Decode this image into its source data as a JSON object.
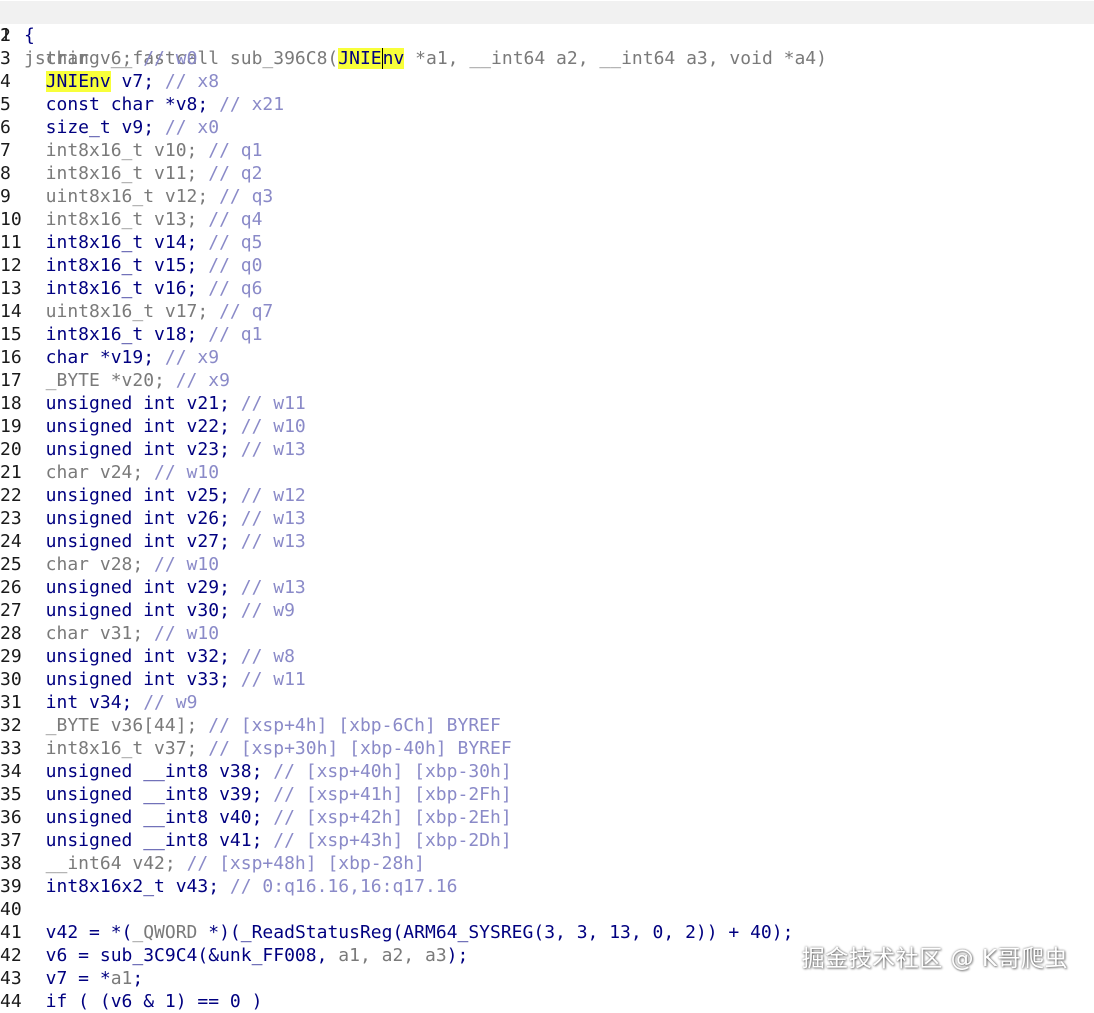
{
  "function_signature_parts": [
    {
      "t": "jstring __fastcall sub_396C8(",
      "c": "t-g"
    },
    {
      "t": "JNIE",
      "c": "t-n hl"
    },
    {
      "t": "nv",
      "c": "t-n hl cursor"
    },
    {
      "t": " *a1, __int64 a2, __int64 a3, void *a4)",
      "c": "t-g"
    }
  ],
  "lines": [
    {
      "n": "2",
      "parts": [
        {
          "t": "{",
          "c": "t-n"
        }
      ]
    },
    {
      "n": "3",
      "parts": [
        {
          "t": "  char v6; ",
          "c": "t-g"
        },
        {
          "t": "// w0",
          "c": "t-c"
        }
      ]
    },
    {
      "n": "4",
      "parts": [
        {
          "t": "  "
        },
        {
          "t": "JNIEnv",
          "c": "t-n hl"
        },
        {
          "t": " v7; ",
          "c": "t-n"
        },
        {
          "t": "// x8",
          "c": "t-c"
        }
      ]
    },
    {
      "n": "5",
      "parts": [
        {
          "t": "  const char *v8; ",
          "c": "t-n"
        },
        {
          "t": "// x21",
          "c": "t-c"
        }
      ]
    },
    {
      "n": "6",
      "parts": [
        {
          "t": "  size_t v9; ",
          "c": "t-n"
        },
        {
          "t": "// x0",
          "c": "t-c"
        }
      ]
    },
    {
      "n": "7",
      "parts": [
        {
          "t": "  int8x16_t v10; ",
          "c": "t-g"
        },
        {
          "t": "// q1",
          "c": "t-c"
        }
      ]
    },
    {
      "n": "8",
      "parts": [
        {
          "t": "  int8x16_t v11; ",
          "c": "t-g"
        },
        {
          "t": "// q2",
          "c": "t-c"
        }
      ]
    },
    {
      "n": "9",
      "parts": [
        {
          "t": "  uint8x16_t v12; ",
          "c": "t-g"
        },
        {
          "t": "// q3",
          "c": "t-c"
        }
      ]
    },
    {
      "n": "10",
      "parts": [
        {
          "t": "  int8x16_t v13; ",
          "c": "t-g"
        },
        {
          "t": "// q4",
          "c": "t-c"
        }
      ]
    },
    {
      "n": "11",
      "parts": [
        {
          "t": "  int8x16_t v14; ",
          "c": "t-n"
        },
        {
          "t": "// q5",
          "c": "t-c"
        }
      ]
    },
    {
      "n": "12",
      "parts": [
        {
          "t": "  int8x16_t v15; ",
          "c": "t-n"
        },
        {
          "t": "// q0",
          "c": "t-c"
        }
      ]
    },
    {
      "n": "13",
      "parts": [
        {
          "t": "  int8x16_t v16; ",
          "c": "t-n"
        },
        {
          "t": "// q6",
          "c": "t-c"
        }
      ]
    },
    {
      "n": "14",
      "parts": [
        {
          "t": "  uint8x16_t v17; ",
          "c": "t-g"
        },
        {
          "t": "// q7",
          "c": "t-c"
        }
      ]
    },
    {
      "n": "15",
      "parts": [
        {
          "t": "  int8x16_t v18; ",
          "c": "t-n"
        },
        {
          "t": "// q1",
          "c": "t-c"
        }
      ]
    },
    {
      "n": "16",
      "parts": [
        {
          "t": "  char *v19; ",
          "c": "t-n"
        },
        {
          "t": "// x9",
          "c": "t-c"
        }
      ]
    },
    {
      "n": "17",
      "parts": [
        {
          "t": "  _BYTE *v20; ",
          "c": "t-g"
        },
        {
          "t": "// x9",
          "c": "t-c"
        }
      ]
    },
    {
      "n": "18",
      "parts": [
        {
          "t": "  unsigned int v21; ",
          "c": "t-n"
        },
        {
          "t": "// w11",
          "c": "t-c"
        }
      ]
    },
    {
      "n": "19",
      "parts": [
        {
          "t": "  unsigned int v22; ",
          "c": "t-n"
        },
        {
          "t": "// w10",
          "c": "t-c"
        }
      ]
    },
    {
      "n": "20",
      "parts": [
        {
          "t": "  unsigned int v23; ",
          "c": "t-n"
        },
        {
          "t": "// w13",
          "c": "t-c"
        }
      ]
    },
    {
      "n": "21",
      "parts": [
        {
          "t": "  char v24; ",
          "c": "t-g"
        },
        {
          "t": "// w10",
          "c": "t-c"
        }
      ]
    },
    {
      "n": "22",
      "parts": [
        {
          "t": "  unsigned int v25; ",
          "c": "t-n"
        },
        {
          "t": "// w12",
          "c": "t-c"
        }
      ]
    },
    {
      "n": "23",
      "parts": [
        {
          "t": "  unsigned int v26; ",
          "c": "t-n"
        },
        {
          "t": "// w13",
          "c": "t-c"
        }
      ]
    },
    {
      "n": "24",
      "parts": [
        {
          "t": "  unsigned int v27; ",
          "c": "t-n"
        },
        {
          "t": "// w13",
          "c": "t-c"
        }
      ]
    },
    {
      "n": "25",
      "parts": [
        {
          "t": "  char v28; ",
          "c": "t-g"
        },
        {
          "t": "// w10",
          "c": "t-c"
        }
      ]
    },
    {
      "n": "26",
      "parts": [
        {
          "t": "  unsigned int v29; ",
          "c": "t-n"
        },
        {
          "t": "// w13",
          "c": "t-c"
        }
      ]
    },
    {
      "n": "27",
      "parts": [
        {
          "t": "  unsigned int v30; ",
          "c": "t-n"
        },
        {
          "t": "// w9",
          "c": "t-c"
        }
      ]
    },
    {
      "n": "28",
      "parts": [
        {
          "t": "  char v31; ",
          "c": "t-g"
        },
        {
          "t": "// w10",
          "c": "t-c"
        }
      ]
    },
    {
      "n": "29",
      "parts": [
        {
          "t": "  unsigned int v32; ",
          "c": "t-n"
        },
        {
          "t": "// w8",
          "c": "t-c"
        }
      ]
    },
    {
      "n": "30",
      "parts": [
        {
          "t": "  unsigned int v33; ",
          "c": "t-n"
        },
        {
          "t": "// w11",
          "c": "t-c"
        }
      ]
    },
    {
      "n": "31",
      "parts": [
        {
          "t": "  int v34; ",
          "c": "t-n"
        },
        {
          "t": "// w9",
          "c": "t-c"
        }
      ]
    },
    {
      "n": "32",
      "parts": [
        {
          "t": "  _BYTE v36[44]; ",
          "c": "t-g"
        },
        {
          "t": "// [xsp+4h] [xbp-6Ch] BYREF",
          "c": "t-c"
        }
      ]
    },
    {
      "n": "33",
      "parts": [
        {
          "t": "  int8x16_t v37; ",
          "c": "t-g"
        },
        {
          "t": "// [xsp+30h] [xbp-40h] BYREF",
          "c": "t-c"
        }
      ]
    },
    {
      "n": "34",
      "parts": [
        {
          "t": "  unsigned __int8 v38; ",
          "c": "t-n"
        },
        {
          "t": "// [xsp+40h] [xbp-30h]",
          "c": "t-c"
        }
      ]
    },
    {
      "n": "35",
      "parts": [
        {
          "t": "  unsigned __int8 v39; ",
          "c": "t-n"
        },
        {
          "t": "// [xsp+41h] [xbp-2Fh]",
          "c": "t-c"
        }
      ]
    },
    {
      "n": "36",
      "parts": [
        {
          "t": "  unsigned __int8 v40; ",
          "c": "t-n"
        },
        {
          "t": "// [xsp+42h] [xbp-2Eh]",
          "c": "t-c"
        }
      ]
    },
    {
      "n": "37",
      "parts": [
        {
          "t": "  unsigned __int8 v41; ",
          "c": "t-n"
        },
        {
          "t": "// [xsp+43h] [xbp-2Dh]",
          "c": "t-c"
        }
      ]
    },
    {
      "n": "38",
      "parts": [
        {
          "t": "  __int64 v42; ",
          "c": "t-g"
        },
        {
          "t": "// [xsp+48h] [xbp-28h]",
          "c": "t-c"
        }
      ]
    },
    {
      "n": "39",
      "parts": [
        {
          "t": "  int8x16x2_t v43; ",
          "c": "t-n"
        },
        {
          "t": "// 0:q16.16,16:q17.16",
          "c": "t-c"
        }
      ]
    },
    {
      "n": "40",
      "parts": []
    },
    {
      "n": "41",
      "parts": [
        {
          "t": "  v42 = *(",
          "c": "t-n"
        },
        {
          "t": "_QWORD",
          "c": "t-g"
        },
        {
          "t": " *)(_ReadStatusReg(ARM64_SYSREG(3, 3, 13, 0, 2)) + 40);",
          "c": "t-n"
        }
      ]
    },
    {
      "n": "42",
      "parts": [
        {
          "t": "  v6 = sub_3C9C4(&unk_FF008, ",
          "c": "t-n"
        },
        {
          "t": "a1, a2, a3",
          "c": "t-g"
        },
        {
          "t": ");",
          "c": "t-n"
        }
      ]
    },
    {
      "n": "43",
      "parts": [
        {
          "t": "  v7 = *",
          "c": "t-n"
        },
        {
          "t": "a1",
          "c": "t-g"
        },
        {
          "t": ";",
          "c": "t-n"
        }
      ]
    },
    {
      "n": "44",
      "parts": [
        {
          "t": "  if ( (v6 & 1) == 0 )",
          "c": "t-n"
        }
      ]
    }
  ],
  "watermark": "掘金技术社区 @ K哥爬虫"
}
